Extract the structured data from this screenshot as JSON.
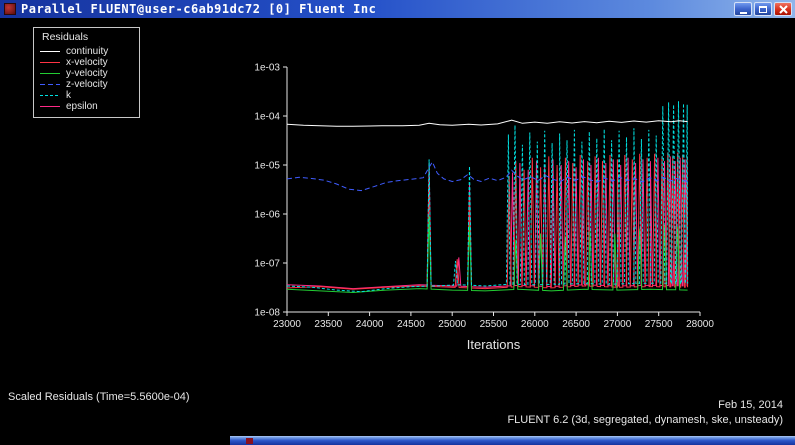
{
  "window": {
    "title": "Parallel FLUENT@user-c6ab91dc72 [0] Fluent Inc"
  },
  "icons": {
    "titlebar_left": "fluent-app-icon",
    "titlebar_right": [
      "minimize-icon",
      "maximize-icon",
      "close-icon"
    ]
  },
  "colors": {
    "titlebar_left": "#16339e",
    "titlebar_right": "#8fb4ea",
    "close_button": "#d72f1a",
    "background": "#000000",
    "axis": "#e6e6e6"
  },
  "legend": {
    "title": "Residuals"
  },
  "footer": {
    "status": "Scaled Residuals  (Time=5.5600e-04)",
    "date": "Feb 15, 2014",
    "version": "FLUENT 6.2 (3d, segregated, dynamesh, ske, unsteady)"
  },
  "chart_data": {
    "type": "line",
    "title": "Scaled Residuals",
    "xlabel": "Iterations",
    "ylabel": "",
    "grid": false,
    "legend_position": "top-left",
    "xlim": [
      23000,
      28000
    ],
    "x_ticks": [
      23000,
      23500,
      24000,
      24500,
      25000,
      25500,
      26000,
      26500,
      27000,
      27500,
      28000
    ],
    "ylog_exponents": [
      -8,
      -3
    ],
    "y_ticks": [
      {
        "label": "1e-03",
        "value": 0.001
      },
      {
        "label": "1e-04",
        "value": 0.0001
      },
      {
        "label": "1e-05",
        "value": 1e-05
      },
      {
        "label": "1e-06",
        "value": 1e-06
      },
      {
        "label": "1e-07",
        "value": 1e-07
      },
      {
        "label": "1e-08",
        "value": 1e-08
      }
    ],
    "axis_color": "#e6e6e6",
    "series": [
      {
        "name": "continuity",
        "color": "#ffffff",
        "dash": "",
        "points": [
          [
            23000,
            6.8e-05
          ],
          [
            23200,
            6.5e-05
          ],
          [
            23400,
            6.3e-05
          ],
          [
            23600,
            6.2e-05
          ],
          [
            23800,
            6.15e-05
          ],
          [
            24000,
            6.25e-05
          ],
          [
            24200,
            6.35e-05
          ],
          [
            24400,
            6.3e-05
          ],
          [
            24600,
            6.5e-05
          ],
          [
            24720,
            7.1e-05
          ],
          [
            24850,
            6.6e-05
          ],
          [
            25000,
            6.45e-05
          ],
          [
            25200,
            6.8e-05
          ],
          [
            25350,
            6.55e-05
          ],
          [
            25550,
            6.9e-05
          ],
          [
            25720,
            8.2e-05
          ],
          [
            25850,
            7.1e-05
          ],
          [
            26000,
            7.5e-05
          ],
          [
            26150,
            7.1e-05
          ],
          [
            26300,
            7.6e-05
          ],
          [
            26450,
            7.2e-05
          ],
          [
            26600,
            7.7e-05
          ],
          [
            26750,
            7.3e-05
          ],
          [
            26900,
            7.8e-05
          ],
          [
            27050,
            7.4e-05
          ],
          [
            27200,
            7.9e-05
          ],
          [
            27350,
            7.5e-05
          ],
          [
            27500,
            8e-05
          ],
          [
            27650,
            7.6e-05
          ],
          [
            27750,
            8e-05
          ],
          [
            27850,
            7.7e-05
          ]
        ]
      },
      {
        "name": "x-velocity",
        "color": "#ff3344",
        "dash": "",
        "base_points": [
          [
            23000,
            3.1e-08
          ],
          [
            23400,
            3.3e-08
          ],
          [
            23800,
            2.9e-08
          ],
          [
            24200,
            3.2e-08
          ],
          [
            24600,
            3.4e-08
          ],
          [
            25000,
            3.2e-08
          ],
          [
            25400,
            3e-08
          ],
          [
            25800,
            3.3e-08
          ],
          [
            26200,
            3.1e-08
          ],
          [
            26600,
            3.4e-08
          ],
          [
            27000,
            3.2e-08
          ],
          [
            27400,
            3.3e-08
          ],
          [
            27850,
            3.2e-08
          ]
        ],
        "spikes": [
          [
            24720,
            5e-06
          ],
          [
            25060,
            1.2e-07
          ],
          [
            25210,
            2.5e-06
          ],
          [
            25690,
            6e-06
          ],
          [
            25770,
            1.2e-05
          ],
          [
            25870,
            8e-06
          ],
          [
            25970,
            1.4e-05
          ],
          [
            26070,
            9e-06
          ],
          [
            26170,
            1.5e-05
          ],
          [
            26270,
            1e-05
          ],
          [
            26370,
            1.4e-05
          ],
          [
            26460,
            1.1e-05
          ],
          [
            26550,
            1.6e-05
          ],
          [
            26640,
            1.2e-05
          ],
          [
            26730,
            1.5e-05
          ],
          [
            26820,
            1.2e-05
          ],
          [
            26910,
            1.6e-05
          ],
          [
            27000,
            1.3e-05
          ],
          [
            27090,
            1.6e-05
          ],
          [
            27180,
            1.3e-05
          ],
          [
            27270,
            1.7e-05
          ],
          [
            27360,
            1.4e-05
          ],
          [
            27450,
            1.7e-05
          ],
          [
            27540,
            1.5e-05
          ],
          [
            27610,
            1.8e-05
          ],
          [
            27670,
            1.5e-05
          ],
          [
            27730,
            1.8e-05
          ],
          [
            27790,
            1.6e-05
          ],
          [
            27845,
            1.5e-05
          ]
        ]
      },
      {
        "name": "y-velocity",
        "color": "#22cc33",
        "dash": "",
        "base_points": [
          [
            23000,
            2.9e-08
          ],
          [
            23400,
            2.7e-08
          ],
          [
            23800,
            2.5e-08
          ],
          [
            24200,
            2.8e-08
          ],
          [
            24600,
            3e-08
          ],
          [
            25000,
            2.8e-08
          ],
          [
            25400,
            2.7e-08
          ],
          [
            25800,
            2.9e-08
          ],
          [
            26200,
            2.7e-08
          ],
          [
            26600,
            2.9e-08
          ],
          [
            27000,
            2.8e-08
          ],
          [
            27400,
            2.9e-08
          ],
          [
            27850,
            2.8e-08
          ]
        ],
        "spikes": [
          [
            24720,
            9e-07
          ],
          [
            25210,
            6e-07
          ],
          [
            25770,
            3e-07
          ],
          [
            26070,
            4e-07
          ],
          [
            26370,
            3.5e-07
          ],
          [
            26670,
            4.5e-07
          ],
          [
            26970,
            4e-07
          ],
          [
            27270,
            5e-07
          ],
          [
            27570,
            6e-07
          ],
          [
            27730,
            5.5e-07
          ]
        ]
      },
      {
        "name": "z-velocity",
        "color": "#3f5cff",
        "dash": "5,3",
        "points": [
          [
            23000,
            5.2e-06
          ],
          [
            23150,
            5.6e-06
          ],
          [
            23300,
            5.3e-06
          ],
          [
            23450,
            4.9e-06
          ],
          [
            23600,
            4.1e-06
          ],
          [
            23750,
            3.2e-06
          ],
          [
            23900,
            3e-06
          ],
          [
            24050,
            3.6e-06
          ],
          [
            24200,
            4.4e-06
          ],
          [
            24350,
            4.8e-06
          ],
          [
            24500,
            5.1e-06
          ],
          [
            24650,
            5.5e-06
          ],
          [
            24720,
            9e-06
          ],
          [
            24760,
            1.15e-05
          ],
          [
            24820,
            6.8e-06
          ],
          [
            24900,
            5.2e-06
          ],
          [
            25000,
            4.6e-06
          ],
          [
            25100,
            5e-06
          ],
          [
            25190,
            6.4e-06
          ],
          [
            25260,
            5.1e-06
          ],
          [
            25350,
            4.6e-06
          ],
          [
            25450,
            5.4e-06
          ],
          [
            25550,
            4.8e-06
          ],
          [
            25650,
            5.6e-06
          ],
          [
            25720,
            7.8e-06
          ],
          [
            25790,
            5.9e-06
          ],
          [
            25860,
            5e-06
          ],
          [
            25950,
            5.8e-06
          ],
          [
            26040,
            4.8e-06
          ],
          [
            26130,
            6.1e-06
          ],
          [
            26220,
            5.1e-06
          ],
          [
            26310,
            4.6e-06
          ],
          [
            26400,
            5.6e-06
          ],
          [
            26490,
            4.8e-06
          ],
          [
            26580,
            5.8e-06
          ],
          [
            26670,
            5e-06
          ],
          [
            26760,
            4.5e-06
          ],
          [
            26850,
            5.4e-06
          ],
          [
            26940,
            4.7e-06
          ],
          [
            27030,
            5.6e-06
          ],
          [
            27120,
            4.8e-06
          ],
          [
            27210,
            5.3e-06
          ],
          [
            27300,
            4.5e-06
          ],
          [
            27390,
            5.5e-06
          ],
          [
            27480,
            4.8e-06
          ],
          [
            27560,
            5.6e-06
          ],
          [
            27640,
            4.7e-06
          ],
          [
            27720,
            5.3e-06
          ],
          [
            27790,
            4.9e-06
          ],
          [
            27850,
            4.6e-06
          ]
        ]
      },
      {
        "name": "k",
        "color": "#00e0e0",
        "dash": "3,2",
        "base_points": [
          [
            23000,
            3.4e-08
          ],
          [
            23300,
            3.2e-08
          ],
          [
            23600,
            2.8e-08
          ],
          [
            23900,
            2.6e-08
          ],
          [
            24200,
            3e-08
          ],
          [
            24500,
            3.3e-08
          ],
          [
            24800,
            3.4e-08
          ],
          [
            25100,
            3.6e-08
          ],
          [
            25400,
            3.4e-08
          ],
          [
            25700,
            3.7e-08
          ],
          [
            26000,
            3.6e-08
          ],
          [
            26300,
            3.7e-08
          ],
          [
            26600,
            3.8e-08
          ],
          [
            26900,
            3.7e-08
          ],
          [
            27200,
            3.8e-08
          ],
          [
            27500,
            3.9e-08
          ],
          [
            27850,
            3.8e-08
          ]
        ],
        "spikes": [
          [
            24720,
            1.3e-05
          ],
          [
            25040,
            1.1e-07
          ],
          [
            25210,
            9.5e-06
          ],
          [
            25680,
            4.2e-05
          ],
          [
            25760,
            6.5e-05
          ],
          [
            25850,
            2.6e-05
          ],
          [
            25940,
            4.6e-05
          ],
          [
            26030,
            3e-05
          ],
          [
            26120,
            5e-05
          ],
          [
            26210,
            2.8e-05
          ],
          [
            26300,
            4.4e-05
          ],
          [
            26390,
            3.2e-05
          ],
          [
            26480,
            5.2e-05
          ],
          [
            26570,
            3e-05
          ],
          [
            26660,
            4.8e-05
          ],
          [
            26750,
            3.5e-05
          ],
          [
            26840,
            5.4e-05
          ],
          [
            26930,
            3.2e-05
          ],
          [
            27020,
            5e-05
          ],
          [
            27110,
            3.7e-05
          ],
          [
            27200,
            5.6e-05
          ],
          [
            27290,
            3.4e-05
          ],
          [
            27380,
            5.2e-05
          ],
          [
            27470,
            4e-05
          ],
          [
            27550,
            0.00016
          ],
          [
            27620,
            0.00019
          ],
          [
            27680,
            0.00017
          ],
          [
            27740,
            0.0002
          ],
          [
            27800,
            0.00018
          ],
          [
            27845,
            0.00017
          ]
        ]
      },
      {
        "name": "epsilon",
        "color": "#ff2a88",
        "dash": "",
        "base_points": [
          [
            23000,
            3.6e-08
          ],
          [
            23400,
            3.4e-08
          ],
          [
            23800,
            3e-08
          ],
          [
            24200,
            3.3e-08
          ],
          [
            24600,
            3.6e-08
          ],
          [
            25000,
            3.4e-08
          ],
          [
            25400,
            3.2e-08
          ],
          [
            25800,
            3.5e-08
          ],
          [
            26200,
            3.3e-08
          ],
          [
            26600,
            3.6e-08
          ],
          [
            27000,
            3.4e-08
          ],
          [
            27400,
            3.5e-08
          ],
          [
            27850,
            3.4e-08
          ]
        ],
        "spikes": [
          [
            24720,
            1.1e-05
          ],
          [
            25080,
            1.3e-07
          ],
          [
            25210,
            4e-06
          ],
          [
            25730,
            7e-06
          ],
          [
            25820,
            1.1e-05
          ],
          [
            25920,
            8e-06
          ],
          [
            26020,
            1.2e-05
          ],
          [
            26120,
            9e-06
          ],
          [
            26220,
            1.3e-05
          ],
          [
            26320,
            1e-05
          ],
          [
            26410,
            1.2e-05
          ],
          [
            26500,
            9e-06
          ],
          [
            26590,
            1.3e-05
          ],
          [
            26680,
            1e-05
          ],
          [
            26770,
            1.4e-05
          ],
          [
            26860,
            1.1e-05
          ],
          [
            26950,
            1.3e-05
          ],
          [
            27040,
            1e-05
          ],
          [
            27130,
            1.4e-05
          ],
          [
            27220,
            1.1e-05
          ],
          [
            27310,
            1.3e-05
          ],
          [
            27400,
            1.2e-05
          ],
          [
            27490,
            1.4e-05
          ],
          [
            27570,
            1.2e-05
          ],
          [
            27640,
            1.5e-05
          ],
          [
            27700,
            1.2e-05
          ],
          [
            27760,
            1.4e-05
          ],
          [
            27820,
            1.3e-05
          ]
        ]
      }
    ]
  }
}
